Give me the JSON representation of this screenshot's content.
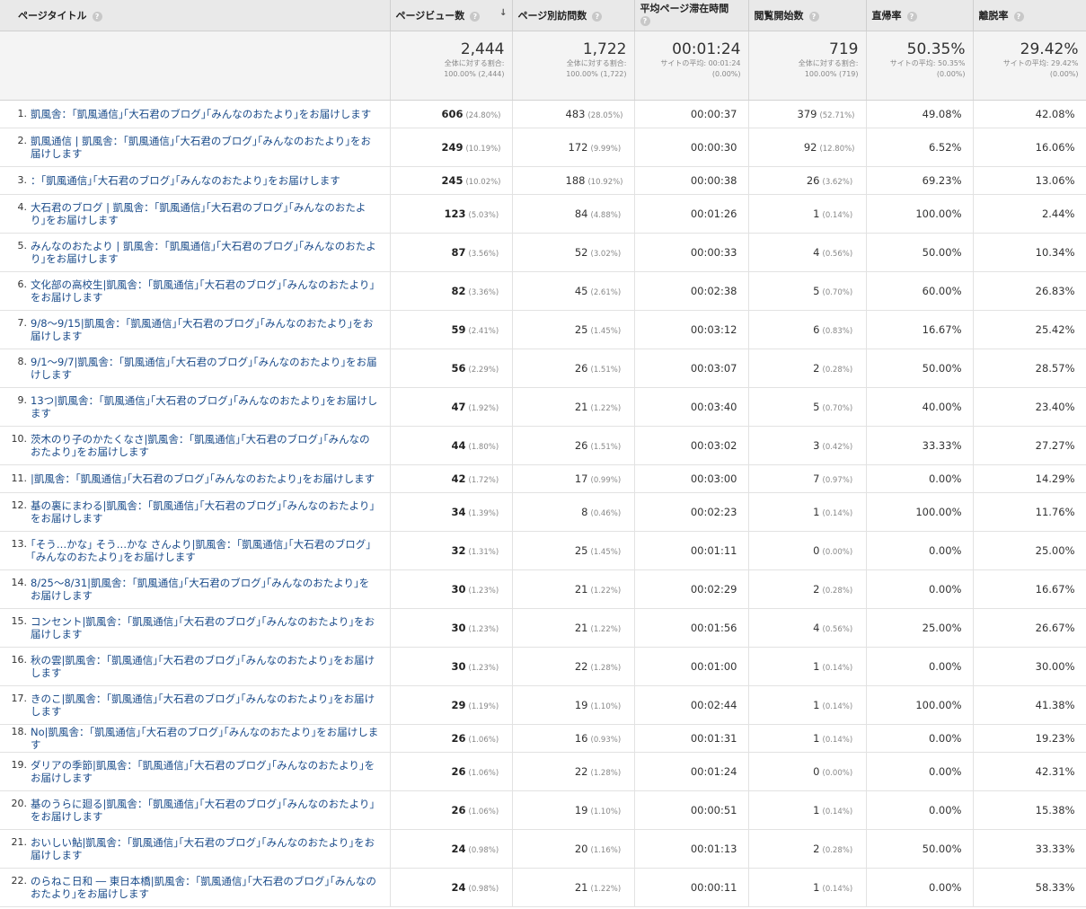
{
  "headers": {
    "title": "ページタイトル",
    "pageviews": "ページビュー数",
    "unique": "ページ別訪問数",
    "avgtime": "平均ページ滞在時間",
    "entrances": "閲覧開始数",
    "bounce": "直帰率",
    "exit": "離脱率"
  },
  "summary": {
    "pageviews": {
      "big": "2,444",
      "sub1": "全体に対する割合:",
      "sub2": "100.00% (2,444)"
    },
    "unique": {
      "big": "1,722",
      "sub1": "全体に対する割合:",
      "sub2": "100.00% (1,722)"
    },
    "avgtime": {
      "big": "00:01:24",
      "sub1": "サイトの平均: 00:01:24",
      "sub2": "(0.00%)"
    },
    "entrances": {
      "big": "719",
      "sub1": "全体に対する割合:",
      "sub2": "100.00% (719)"
    },
    "bounce": {
      "big": "50.35%",
      "sub1": "サイトの平均: 50.35%",
      "sub2": "(0.00%)"
    },
    "exit": {
      "big": "29.42%",
      "sub1": "サイトの平均: 29.42%",
      "sub2": "(0.00%)"
    }
  },
  "rows": [
    {
      "idx": "1.",
      "title": "凱風舎：｢凱風通信｣｢大石君のブログ｣｢みんなのおたより｣をお届けします",
      "pv": "606",
      "pvp": "(24.80%)",
      "uv": "483",
      "uvp": "(28.05%)",
      "time": "00:00:37",
      "ent": "379",
      "entp": "(52.71%)",
      "bounce": "49.08%",
      "exit": "42.08%"
    },
    {
      "idx": "2.",
      "title": "凱風通信 | 凱風舎：｢凱風通信｣｢大石君のブログ｣｢みんなのおたより｣をお届けします",
      "pv": "249",
      "pvp": "(10.19%)",
      "uv": "172",
      "uvp": "(9.99%)",
      "time": "00:00:30",
      "ent": "92",
      "entp": "(12.80%)",
      "bounce": "6.52%",
      "exit": "16.06%"
    },
    {
      "idx": "3.",
      "title": "：｢凱風通信｣｢大石君のブログ｣｢みんなのおたより｣をお届けします",
      "pv": "245",
      "pvp": "(10.02%)",
      "uv": "188",
      "uvp": "(10.92%)",
      "time": "00:00:38",
      "ent": "26",
      "entp": "(3.62%)",
      "bounce": "69.23%",
      "exit": "13.06%"
    },
    {
      "idx": "4.",
      "title": "大石君のブログ | 凱風舎：｢凱風通信｣｢大石君のブログ｣｢みんなのおたより｣をお届けします",
      "pv": "123",
      "pvp": "(5.03%)",
      "uv": "84",
      "uvp": "(4.88%)",
      "time": "00:01:26",
      "ent": "1",
      "entp": "(0.14%)",
      "bounce": "100.00%",
      "exit": "2.44%"
    },
    {
      "idx": "5.",
      "title": "みんなのおたより | 凱風舎：｢凱風通信｣｢大石君のブログ｣｢みんなのおたより｣をお届けします",
      "pv": "87",
      "pvp": "(3.56%)",
      "uv": "52",
      "uvp": "(3.02%)",
      "time": "00:00:33",
      "ent": "4",
      "entp": "(0.56%)",
      "bounce": "50.00%",
      "exit": "10.34%"
    },
    {
      "idx": "6.",
      "title": "文化部の高校生|凱風舎：｢凱風通信｣｢大石君のブログ｣｢みんなのおたより｣をお届けします",
      "pv": "82",
      "pvp": "(3.36%)",
      "uv": "45",
      "uvp": "(2.61%)",
      "time": "00:02:38",
      "ent": "5",
      "entp": "(0.70%)",
      "bounce": "60.00%",
      "exit": "26.83%"
    },
    {
      "idx": "7.",
      "title": "9/8〜9/15|凱風舎：｢凱風通信｣｢大石君のブログ｣｢みんなのおたより｣をお届けします",
      "pv": "59",
      "pvp": "(2.41%)",
      "uv": "25",
      "uvp": "(1.45%)",
      "time": "00:03:12",
      "ent": "6",
      "entp": "(0.83%)",
      "bounce": "16.67%",
      "exit": "25.42%"
    },
    {
      "idx": "8.",
      "title": "9/1〜9/7|凱風舎：｢凱風通信｣｢大石君のブログ｣｢みんなのおたより｣をお届けします",
      "pv": "56",
      "pvp": "(2.29%)",
      "uv": "26",
      "uvp": "(1.51%)",
      "time": "00:03:07",
      "ent": "2",
      "entp": "(0.28%)",
      "bounce": "50.00%",
      "exit": "28.57%"
    },
    {
      "idx": "9.",
      "title": "13つ|凱風舎：｢凱風通信｣｢大石君のブログ｣｢みんなのおたより｣をお届けします",
      "pv": "47",
      "pvp": "(1.92%)",
      "uv": "21",
      "uvp": "(1.22%)",
      "time": "00:03:40",
      "ent": "5",
      "entp": "(0.70%)",
      "bounce": "40.00%",
      "exit": "23.40%"
    },
    {
      "idx": "10.",
      "title": "茨木のり子のかたくなさ|凱風舎：｢凱風通信｣｢大石君のブログ｣｢みんなのおたより｣をお届けします",
      "pv": "44",
      "pvp": "(1.80%)",
      "uv": "26",
      "uvp": "(1.51%)",
      "time": "00:03:02",
      "ent": "3",
      "entp": "(0.42%)",
      "bounce": "33.33%",
      "exit": "27.27%"
    },
    {
      "idx": "11.",
      "title": "|凱風舎：｢凱風通信｣｢大石君のブログ｣｢みんなのおたより｣をお届けします",
      "pv": "42",
      "pvp": "(1.72%)",
      "uv": "17",
      "uvp": "(0.99%)",
      "time": "00:03:00",
      "ent": "7",
      "entp": "(0.97%)",
      "bounce": "0.00%",
      "exit": "14.29%"
    },
    {
      "idx": "12.",
      "title": "基の裏にまわる|凱風舎：｢凱風通信｣｢大石君のブログ｣｢みんなのおたより｣をお届けします",
      "pv": "34",
      "pvp": "(1.39%)",
      "uv": "8",
      "uvp": "(0.46%)",
      "time": "00:02:23",
      "ent": "1",
      "entp": "(0.14%)",
      "bounce": "100.00%",
      "exit": "11.76%"
    },
    {
      "idx": "13.",
      "title": "｢そう…かな｣ そう…かな さんより|凱風舎：｢凱風通信｣｢大石君のブログ｣｢みんなのおたより｣をお届けします",
      "pv": "32",
      "pvp": "(1.31%)",
      "uv": "25",
      "uvp": "(1.45%)",
      "time": "00:01:11",
      "ent": "0",
      "entp": "(0.00%)",
      "bounce": "0.00%",
      "exit": "25.00%"
    },
    {
      "idx": "14.",
      "title": "8/25〜8/31|凱風舎：｢凱風通信｣｢大石君のブログ｣｢みんなのおたより｣をお届けします",
      "pv": "30",
      "pvp": "(1.23%)",
      "uv": "21",
      "uvp": "(1.22%)",
      "time": "00:02:29",
      "ent": "2",
      "entp": "(0.28%)",
      "bounce": "0.00%",
      "exit": "16.67%"
    },
    {
      "idx": "15.",
      "title": "コンセント|凱風舎：｢凱風通信｣｢大石君のブログ｣｢みんなのおたより｣をお届けします",
      "pv": "30",
      "pvp": "(1.23%)",
      "uv": "21",
      "uvp": "(1.22%)",
      "time": "00:01:56",
      "ent": "4",
      "entp": "(0.56%)",
      "bounce": "25.00%",
      "exit": "26.67%"
    },
    {
      "idx": "16.",
      "title": "秋の雲|凱風舎：｢凱風通信｣｢大石君のブログ｣｢みんなのおたより｣をお届けします",
      "pv": "30",
      "pvp": "(1.23%)",
      "uv": "22",
      "uvp": "(1.28%)",
      "time": "00:01:00",
      "ent": "1",
      "entp": "(0.14%)",
      "bounce": "0.00%",
      "exit": "30.00%"
    },
    {
      "idx": "17.",
      "title": "きのこ|凱風舎：｢凱風通信｣｢大石君のブログ｣｢みんなのおたより｣をお届けします",
      "pv": "29",
      "pvp": "(1.19%)",
      "uv": "19",
      "uvp": "(1.10%)",
      "time": "00:02:44",
      "ent": "1",
      "entp": "(0.14%)",
      "bounce": "100.00%",
      "exit": "41.38%"
    },
    {
      "idx": "18.",
      "title": "No|凱風舎：｢凱風通信｣｢大石君のブログ｣｢みんなのおたより｣をお届けします",
      "pv": "26",
      "pvp": "(1.06%)",
      "uv": "16",
      "uvp": "(0.93%)",
      "time": "00:01:31",
      "ent": "1",
      "entp": "(0.14%)",
      "bounce": "0.00%",
      "exit": "19.23%"
    },
    {
      "idx": "19.",
      "title": "ダリアの季節|凱風舎：｢凱風通信｣｢大石君のブログ｣｢みんなのおたより｣をお届けします",
      "pv": "26",
      "pvp": "(1.06%)",
      "uv": "22",
      "uvp": "(1.28%)",
      "time": "00:01:24",
      "ent": "0",
      "entp": "(0.00%)",
      "bounce": "0.00%",
      "exit": "42.31%"
    },
    {
      "idx": "20.",
      "title": "基のうらに廻る|凱風舎：｢凱風通信｣｢大石君のブログ｣｢みんなのおたより｣をお届けします",
      "pv": "26",
      "pvp": "(1.06%)",
      "uv": "19",
      "uvp": "(1.10%)",
      "time": "00:00:51",
      "ent": "1",
      "entp": "(0.14%)",
      "bounce": "0.00%",
      "exit": "15.38%"
    },
    {
      "idx": "21.",
      "title": "おいしい鮎|凱風舎：｢凱風通信｣｢大石君のブログ｣｢みんなのおたより｣をお届けします",
      "pv": "24",
      "pvp": "(0.98%)",
      "uv": "20",
      "uvp": "(1.16%)",
      "time": "00:01:13",
      "ent": "2",
      "entp": "(0.28%)",
      "bounce": "50.00%",
      "exit": "33.33%"
    },
    {
      "idx": "22.",
      "title": "のらねこ日和 ― 東日本橋|凱風舎：｢凱風通信｣｢大石君のブログ｣｢みんなのおたより｣をお届けします",
      "pv": "24",
      "pvp": "(0.98%)",
      "uv": "21",
      "uvp": "(1.22%)",
      "time": "00:00:11",
      "ent": "1",
      "entp": "(0.14%)",
      "bounce": "0.00%",
      "exit": "58.33%"
    }
  ],
  "short_rows": [
    0,
    2,
    10,
    17
  ]
}
